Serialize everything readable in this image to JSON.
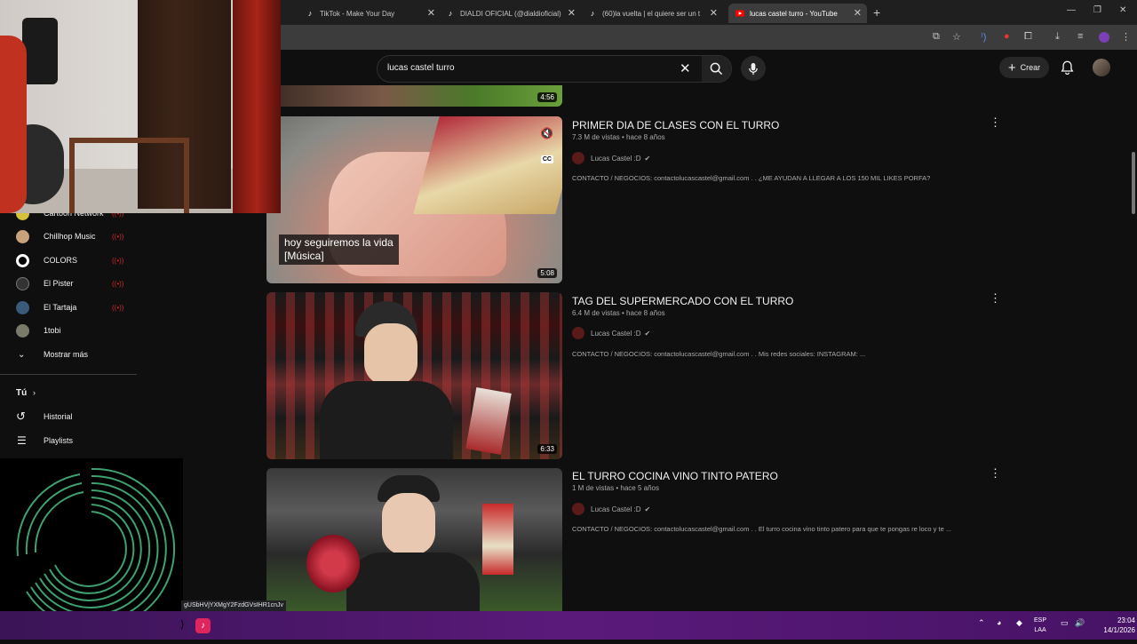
{
  "browser": {
    "tabs": [
      {
        "title": "TikTok - Make Your Day",
        "icon": "tiktok-icon"
      },
      {
        "title": "DIALDI OFICIAL (@dialdioficial)",
        "icon": "tiktok-icon"
      },
      {
        "title": "(60)la vuelta | el quiere ser un t",
        "icon": "tiktok-icon"
      },
      {
        "title": "lucas castel turro - YouTube",
        "icon": "youtube-icon",
        "active": true
      }
    ]
  },
  "youtube": {
    "search_value": "lucas castel turro",
    "create_label": "Crear"
  },
  "sidebar": {
    "subscriptions": [
      {
        "label": "Cartoon Network",
        "live": "((•))"
      },
      {
        "label": "Chillhop Music",
        "live": "((•))"
      },
      {
        "label": "COLORS",
        "live": "((•))"
      },
      {
        "label": "El Pister",
        "live": "((•))"
      },
      {
        "label": "El Tartaja",
        "live": "((•))"
      },
      {
        "label": "1tobi",
        "live": ""
      }
    ],
    "show_more": "Mostrar más",
    "you_section": "Tú",
    "history": "Historial",
    "playlists": "Playlists"
  },
  "results": [
    {
      "duration": "4:56"
    },
    {
      "title": "PRIMER DIA DE CLASES CON EL TURRO",
      "meta": "7.3 M de vistas • hace 8 años",
      "channel": "Lucas Castel :D",
      "description": "CONTACTO / NEGOCIOS: contactolucascastel@gmail.com . . ¿ME AYUDAN A LLEGAR A LOS 150 MIL LIKES PORFA?",
      "duration": "5:08",
      "caption_line1": "hoy seguiremos la vida",
      "caption_line2": "[Música]",
      "cc_label": "CC"
    },
    {
      "title": "TAG DEL SUPERMERCADO CON EL TURRO",
      "meta": "6.4 M de vistas • hace 8 años",
      "channel": "Lucas Castel :D",
      "description": "CONTACTO / NEGOCIOS: contactolucascastel@gmail.com . . Mis redes sociales: INSTAGRAM: ...",
      "duration": "6:33"
    },
    {
      "title": "EL TURRO COCINA VINO TINTO PATERO",
      "meta": "1 M de vistas • hace 5 años",
      "channel": "Lucas Castel :D",
      "description": "CONTACTO / NEGOCIOS: contactolucascastel@gmail.com . . El turro cocina vino tinto patero para que te pongas re loco y te ..."
    }
  ],
  "status_url": "gUSbHVjYXMgY2FzdGVsIHR1cnJv",
  "taskbar": {
    "lang_line1": "ESP",
    "lang_line2": "LAA",
    "time": "23:04",
    "date": "14/1/2026"
  }
}
